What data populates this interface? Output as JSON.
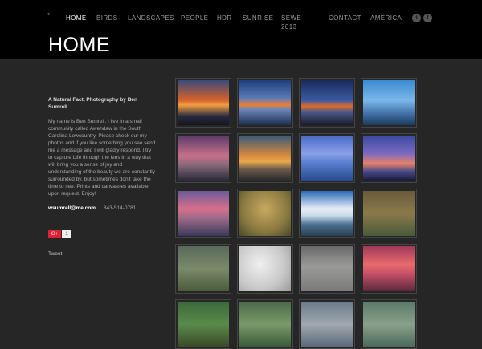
{
  "site": {
    "logo_mark": "°"
  },
  "nav": {
    "items": [
      {
        "label": "HOME",
        "active": true
      },
      {
        "label": "BIRDS"
      },
      {
        "label": "LANDSCAPES"
      },
      {
        "label": "PEOPLE"
      },
      {
        "label": "HDR"
      },
      {
        "label": "SUNRISE"
      },
      {
        "label": "SEWE\n2013"
      },
      {
        "label": "CONTACT"
      },
      {
        "label": "AMERICA"
      }
    ]
  },
  "social": [
    {
      "name": "twitter-icon",
      "glyph": "t"
    },
    {
      "name": "facebook-icon",
      "glyph": "f"
    }
  ],
  "page": {
    "title": "HOME"
  },
  "sidebar": {
    "heading": "A Natural Fact, Photography by Ben Sumrell",
    "bio": "My name is Ben Sumrell. I live in a small community called Awendaw in the South Carolina Lowcountry. Please check our my photos and if you like something you see send me a message and I will gladly respond. I try to capture Life through the lens in a way that will bring you a sense of joy and understanding of the beauty we are constantly surrounded by, but sometimes don't take the time to see. Prints and canvasses available upon request. Enjoy!",
    "email": "wsumrell@me.com",
    "phone": "843-514-0781",
    "gplus_label": "G+",
    "gplus_count": "1",
    "tweet_label": "Tweet"
  },
  "gallery": {
    "thumbs": [
      {
        "name": "sunset-driftwood",
        "bg": "linear-gradient(#3a4a7a 0%, #d8622a 45%, #f0a040 55%, #2a2a40 80%, #151520 100%)"
      },
      {
        "name": "blue-horizon",
        "bg": "linear-gradient(#1f3f7a 0%, #5a7ab8 40%, #e8803a 55%, #6a86b8 65%, #1e2e50 100%)"
      },
      {
        "name": "dusk-beach",
        "bg": "linear-gradient(#1a2a5a 0%, #3a5aa0 45%, #e06a2a 58%, #4a5a8a 70%, #1a1a2a 100%)"
      },
      {
        "name": "blue-sky-driftwood",
        "bg": "linear-gradient(#3a8ad0 0%, #7ab8e8 45%, #4a7ab0 70%, #1a3a60 100%)"
      },
      {
        "name": "pink-sky-tree",
        "bg": "linear-gradient(#5a3a6a 0%, #c8708a 45%, #8a6a7a 65%, #2a2a3a 100%)"
      },
      {
        "name": "golden-driftwood",
        "bg": "linear-gradient(#3a5a7a 0%, #d88a3a 45%, #e8a850 58%, #6a5a4a 75%, #2a2a2a 100%)"
      },
      {
        "name": "blue-lagoon",
        "bg": "linear-gradient(#4a6ac8 0%, #8aa0e8 40%, #5a80d0 60%, #2a4a90 100%)"
      },
      {
        "name": "purple-clouds",
        "bg": "linear-gradient(#3a4aa0 0%, #7a6ac0 40%, #e8806a 62%, #4a4a8a 80%, #1a1a3a 100%)"
      },
      {
        "name": "pink-water-dusk",
        "bg": "linear-gradient(#6a5a9a 0%, #d8708a 40%, #a06a8a 60%, #3a3a5a 100%)"
      },
      {
        "name": "heron-green",
        "bg": "radial-gradient(circle at 50% 40%, #c8a860 0%, #8a7a40 60%, #4a4a2a 100%)"
      },
      {
        "name": "clouds-blue",
        "bg": "linear-gradient(#2a6ab8 0%, #e8eef8 40%, #c8d8e8 55%, #4a7090 75%, #2a4050 100%)"
      },
      {
        "name": "kingfisher-branch",
        "bg": "linear-gradient(#6a5a3a 0%, #8a7a4a 50%, #4a5a3a 100%)"
      },
      {
        "name": "blue-heron-marsh",
        "bg": "linear-gradient(#5a6a5a 0%, #7a8a6a 50%, #4a5a3a 100%)"
      },
      {
        "name": "kingfisher-white",
        "bg": "radial-gradient(circle at 40% 40%, #f0f0f0 0%, #c8c8c8 60%, #9a9a9a 100%)"
      },
      {
        "name": "otter-sand",
        "bg": "linear-gradient(#6a6a6a 0%, #9a9a98 45%, #7a7a78 100%)"
      },
      {
        "name": "red-sky-pier",
        "bg": "linear-gradient(#a03a5a 0%, #e86a6a 40%, #c8506a 60%, #5a2a3a 100%)"
      },
      {
        "name": "oak-trees",
        "bg": "linear-gradient(#3a6a3a 0%, #5a8a4a 50%, #3a4a2a 100%)"
      },
      {
        "name": "moss-trees",
        "bg": "linear-gradient(#4a6a4a 0%, #7a9a6a 50%, #3a5a3a 100%)"
      },
      {
        "name": "pelican",
        "bg": "linear-gradient(#6a7a8a 0%, #a0a8b0 50%, #5a6a7a 100%)"
      },
      {
        "name": "bird-flight",
        "bg": "linear-gradient(#5a7a6a 0%, #8aa08a 50%, #4a6a5a 100%)"
      }
    ]
  }
}
